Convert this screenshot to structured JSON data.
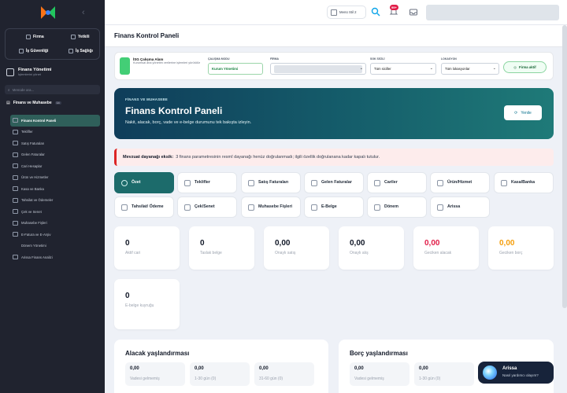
{
  "sidebar": {
    "quick_links": [
      "Firma",
      "Yetkili",
      "İş Güvenliği",
      "İş Sağlığı"
    ],
    "module_title": "Finans Yönetimi",
    "module_subtitle": "İşlemlerini yönet",
    "search_placeholder": "Menüde ara...",
    "group_title": "Finans ve Muhasebe",
    "group_count": "14",
    "items": [
      {
        "label": "Finans Kontrol Paneli",
        "active": true
      },
      {
        "label": "Teklifler"
      },
      {
        "label": "Satış Faturaları"
      },
      {
        "label": "Gelen Faturalar"
      },
      {
        "label": "Cari Hesaplar"
      },
      {
        "label": "Ürün ve Hizmetler"
      },
      {
        "label": "Kasa ve Banka"
      },
      {
        "label": "Tahsilat ve Ödemeler"
      },
      {
        "label": "Çek ve Senet"
      },
      {
        "label": "Muhasebe Fişleri"
      },
      {
        "label": "E-Fatura ve E-Arşiv"
      },
      {
        "label": "Dönem Yönetimi",
        "sub": true
      },
      {
        "label": "Arissa Finans Analizi"
      }
    ]
  },
  "topbar": {
    "module_button": "Menü Stil 2",
    "notification_badge": "99+"
  },
  "page": {
    "title": "Finans Kontrol Paneli"
  },
  "filters": {
    "workspace_title": "İSG Çalışma Alanı",
    "workspace_desc": "Kurumsal ana yönetim verilerine işlemleri yürütülür",
    "mode_label": "ÇALIŞMA MODU",
    "mode_value": "Kurum Yönetimi",
    "company_label": "FİRMA",
    "sgk_label": "SGK SİCİLİ",
    "sgk_value": "Tüm siciller",
    "location_label": "LOKASYON",
    "location_value": "Tüm lokasyonlar",
    "status_button": "Firma aktif"
  },
  "hero": {
    "eyebrow": "FİNANS VE MUHASEBE",
    "title": "Finans Kontrol Paneli",
    "subtitle": "Nakit, alacak, borç, vade ve e-belge durumunu tek bakışta izleyin.",
    "refresh_label": "Yenile"
  },
  "alert": {
    "strong": "Mevzuat dayanağı eksik:",
    "text": "3 finans parametresinin resmî dayanağı henüz doğrulanmadı; ilgili özellik doğrulanana kadar kapalı tutulur."
  },
  "tabs": [
    {
      "label": "Özet",
      "icon": "gauge-icon",
      "active": true
    },
    {
      "label": "Teklifler",
      "icon": "document-icon"
    },
    {
      "label": "Satış Faturaları",
      "icon": "invoice-icon"
    },
    {
      "label": "Gelen Faturalar",
      "icon": "invoice-in-icon"
    },
    {
      "label": "Cariler",
      "icon": "contacts-icon"
    },
    {
      "label": "Ürün/Hizmet",
      "icon": "box-icon"
    },
    {
      "label": "Kasa/Banka",
      "icon": "bank-icon"
    },
    {
      "label": "Tahsilat/ Ödeme",
      "icon": "exchange-icon"
    },
    {
      "label": "Çek/Senet",
      "icon": "cheque-icon"
    },
    {
      "label": "Muhasebe Fişleri",
      "icon": "ledger-icon"
    },
    {
      "label": "E-Belge",
      "icon": "send-icon"
    },
    {
      "label": "Dönem",
      "icon": "calendar-icon"
    },
    {
      "label": "Arissa",
      "icon": "sparkle-icon"
    }
  ],
  "stats": [
    {
      "value": "0",
      "label": "Aktif cari",
      "color": "#111827"
    },
    {
      "value": "0",
      "label": "Taslak belge",
      "color": "#111827"
    },
    {
      "value": "0,00",
      "label": "Onaylı satış",
      "color": "#111827"
    },
    {
      "value": "0,00",
      "label": "Onaylı alış",
      "color": "#111827"
    },
    {
      "value": "0,00",
      "label": "Geciken alacak",
      "color": "#e11d48"
    },
    {
      "value": "0,00",
      "label": "Geciken borç",
      "color": "#f59e0b"
    },
    {
      "value": "0",
      "label": "E-belge kuyruğu",
      "color": "#111827"
    }
  ],
  "receivables": {
    "title": "Alacak yaşlandırması",
    "cells": [
      {
        "value": "0,00",
        "label": "Vadesi gelmemiş"
      },
      {
        "value": "0,00",
        "label": "1-30 gün (0)"
      },
      {
        "value": "0,00",
        "label": "31-60 gün (0)"
      }
    ]
  },
  "payables": {
    "title": "Borç yaşlandırması",
    "cells": [
      {
        "value": "0,00",
        "label": "Vadesi gelmemiş"
      },
      {
        "value": "0,00",
        "label": "1-30 gün (0)"
      }
    ]
  },
  "assistant": {
    "name": "Arissa",
    "subtitle": "Nasıl yardımcı olayım?"
  }
}
